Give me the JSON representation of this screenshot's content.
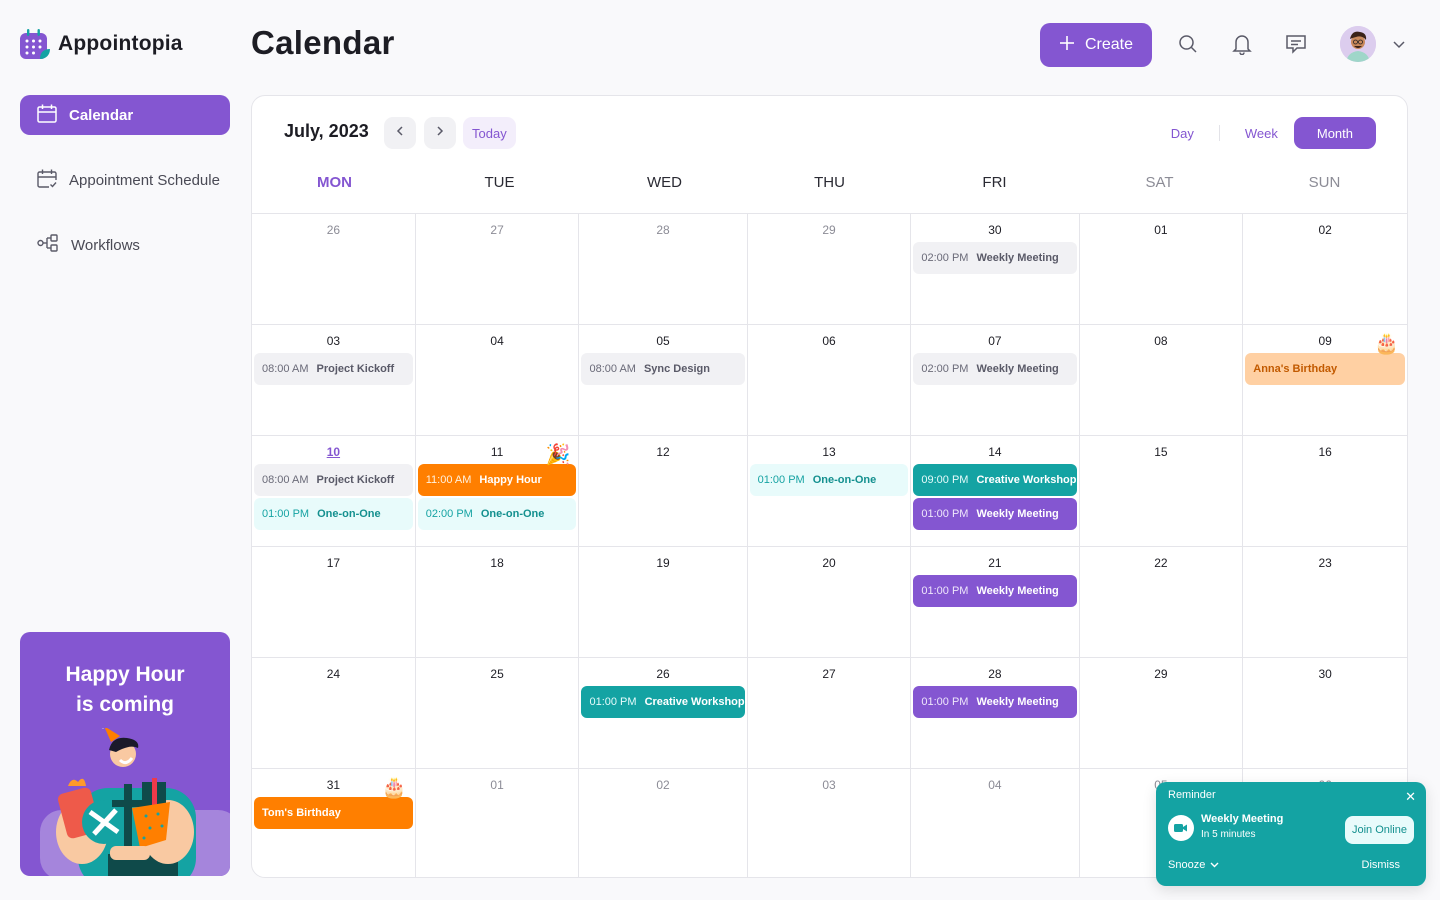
{
  "app": {
    "name": "Appointopia",
    "brand_color": "#8456d1"
  },
  "sidebar": {
    "items": [
      {
        "label": "Calendar",
        "icon": "calendar-icon",
        "active": true
      },
      {
        "label": "Appointment Schedule",
        "icon": "calendar-check-icon",
        "active": false
      },
      {
        "label": "Workflows",
        "icon": "workflow-icon",
        "active": false
      }
    ],
    "promo": {
      "line1": "Happy Hour",
      "line2": "is coming"
    }
  },
  "header": {
    "title": "Calendar",
    "create_label": "Create",
    "icons": [
      "search-icon",
      "bell-icon",
      "message-icon"
    ]
  },
  "calendar": {
    "month_label": "July, 2023",
    "today_label": "Today",
    "views": [
      "Day",
      "Week",
      "Month"
    ],
    "active_view": "Month",
    "weekdays": [
      "MON",
      "TUE",
      "WED",
      "THU",
      "FRI",
      "SAT",
      "SUN"
    ],
    "weeks": [
      [
        {
          "day": "26",
          "other": true,
          "events": []
        },
        {
          "day": "27",
          "other": true,
          "events": []
        },
        {
          "day": "28",
          "other": true,
          "events": []
        },
        {
          "day": "29",
          "other": true,
          "events": []
        },
        {
          "day": "30",
          "events": [
            {
              "time": "02:00 PM",
              "title": "Weekly Meeting",
              "style": "gray"
            }
          ]
        },
        {
          "day": "01",
          "events": []
        },
        {
          "day": "02",
          "events": []
        }
      ],
      [
        {
          "day": "03",
          "events": [
            {
              "time": "08:00 AM",
              "title": "Project Kickoff",
              "style": "gray"
            }
          ]
        },
        {
          "day": "04",
          "events": []
        },
        {
          "day": "05",
          "events": [
            {
              "time": "08:00 AM",
              "title": "Sync Design",
              "style": "gray"
            }
          ]
        },
        {
          "day": "06",
          "events": []
        },
        {
          "day": "07",
          "events": [
            {
              "time": "02:00 PM",
              "title": "Weekly Meeting",
              "style": "gray"
            }
          ]
        },
        {
          "day": "08",
          "events": []
        },
        {
          "day": "09",
          "emoji": "🎂",
          "events": [
            {
              "time": "",
              "title": "Anna's Birthday",
              "style": "peach"
            }
          ]
        }
      ],
      [
        {
          "day": "10",
          "today": true,
          "events": [
            {
              "time": "08:00 AM",
              "title": "Project Kickoff",
              "style": "gray"
            },
            {
              "time": "01:00 PM",
              "title": "One-on-One",
              "style": "cyan"
            }
          ]
        },
        {
          "day": "11",
          "emoji": "🎉",
          "events": [
            {
              "time": "11:00 AM",
              "title": "Happy Hour",
              "style": "orange"
            },
            {
              "time": "02:00 PM",
              "title": "One-on-One",
              "style": "cyan"
            }
          ]
        },
        {
          "day": "12",
          "events": []
        },
        {
          "day": "13",
          "events": [
            {
              "time": "01:00 PM",
              "title": "One-on-One",
              "style": "cyan"
            }
          ]
        },
        {
          "day": "14",
          "events": [
            {
              "time": "09:00 PM",
              "title": "Creative Workshop",
              "style": "teal"
            },
            {
              "time": "01:00 PM",
              "title": "Weekly Meeting",
              "style": "purple"
            }
          ]
        },
        {
          "day": "15",
          "events": []
        },
        {
          "day": "16",
          "events": []
        }
      ],
      [
        {
          "day": "17",
          "events": []
        },
        {
          "day": "18",
          "events": []
        },
        {
          "day": "19",
          "events": []
        },
        {
          "day": "20",
          "events": []
        },
        {
          "day": "21",
          "events": [
            {
              "time": "01:00 PM",
              "title": "Weekly Meeting",
              "style": "purple"
            }
          ]
        },
        {
          "day": "22",
          "events": []
        },
        {
          "day": "23",
          "events": []
        }
      ],
      [
        {
          "day": "24",
          "events": []
        },
        {
          "day": "25",
          "events": []
        },
        {
          "day": "26",
          "events": [
            {
              "time": "01:00 PM",
              "title": "Creative Workshop",
              "style": "teal"
            }
          ]
        },
        {
          "day": "27",
          "events": []
        },
        {
          "day": "28",
          "events": [
            {
              "time": "01:00 PM",
              "title": "Weekly Meeting",
              "style": "purple"
            }
          ]
        },
        {
          "day": "29",
          "events": []
        },
        {
          "day": "30",
          "events": []
        }
      ],
      [
        {
          "day": "31",
          "emoji": "🎂",
          "events": [
            {
              "time": "",
              "title": "Tom's Birthday",
              "style": "orange"
            }
          ]
        },
        {
          "day": "01",
          "other": true,
          "events": []
        },
        {
          "day": "02",
          "other": true,
          "events": []
        },
        {
          "day": "03",
          "other": true,
          "events": []
        },
        {
          "day": "04",
          "other": true,
          "events": []
        },
        {
          "day": "05",
          "other": true,
          "events": []
        },
        {
          "day": "06",
          "other": true,
          "events": []
        }
      ]
    ]
  },
  "reminder": {
    "label": "Reminder",
    "title": "Weekly Meeting",
    "subtitle": "In 5 minutes",
    "join_label": "Join Online",
    "snooze_label": "Snooze",
    "dismiss_label": "Dismiss",
    "close_glyph": "✕",
    "color": "#14a3a3"
  }
}
